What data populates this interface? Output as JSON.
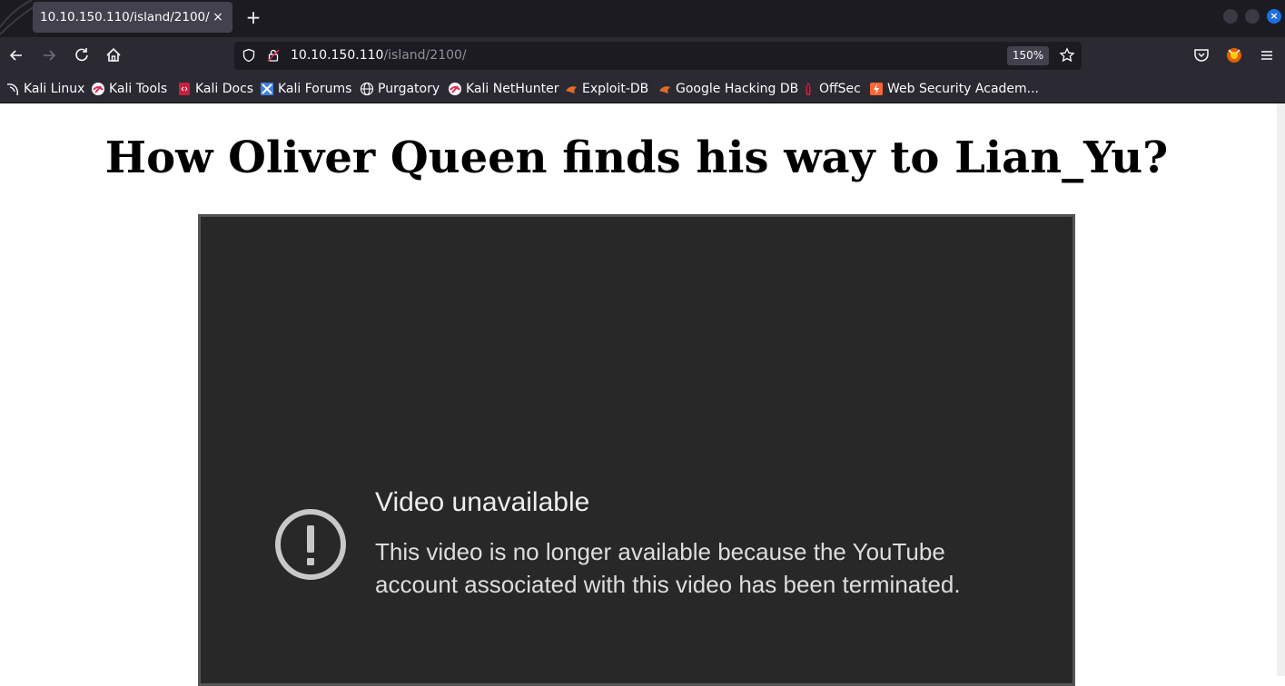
{
  "browser": {
    "tab": {
      "title": "10.10.150.110/island/2100/",
      "close_glyph": "×"
    },
    "new_tab_glyph": "+",
    "window_close_glyph": "×",
    "url": {
      "host": "10.10.150.110",
      "path": "/island/2100/"
    },
    "zoom": "150%",
    "bookmarks": [
      {
        "label": "Kali Linux",
        "icon": "kali-dragon-icon"
      },
      {
        "label": "Kali Tools",
        "icon": "kali-tools-icon"
      },
      {
        "label": "Kali Docs",
        "icon": "kali-docs-icon"
      },
      {
        "label": "Kali Forums",
        "icon": "kali-forums-icon"
      },
      {
        "label": "Purgatory",
        "icon": "globe-icon"
      },
      {
        "label": "Kali NetHunter",
        "icon": "kali-nethunter-icon"
      },
      {
        "label": "Exploit-DB",
        "icon": "exploit-db-icon"
      },
      {
        "label": "Google Hacking DB",
        "icon": "ghdb-icon"
      },
      {
        "label": "OffSec",
        "icon": "offsec-icon"
      },
      {
        "label": "Web Security Academ...",
        "icon": "portswigger-icon"
      }
    ]
  },
  "page": {
    "heading": "How Oliver Queen finds his way to Lian_Yu?",
    "video": {
      "title": "Video unavailable",
      "message": "This video is no longer available because the YouTube account associated with this video has been terminated.",
      "icon": "warning-circle-icon"
    }
  },
  "colors": {
    "tabstrip": "#1c1b22",
    "toolbar": "#2b2a33",
    "video_bg": "#282828",
    "accent_blue": "#1d6fe2"
  }
}
